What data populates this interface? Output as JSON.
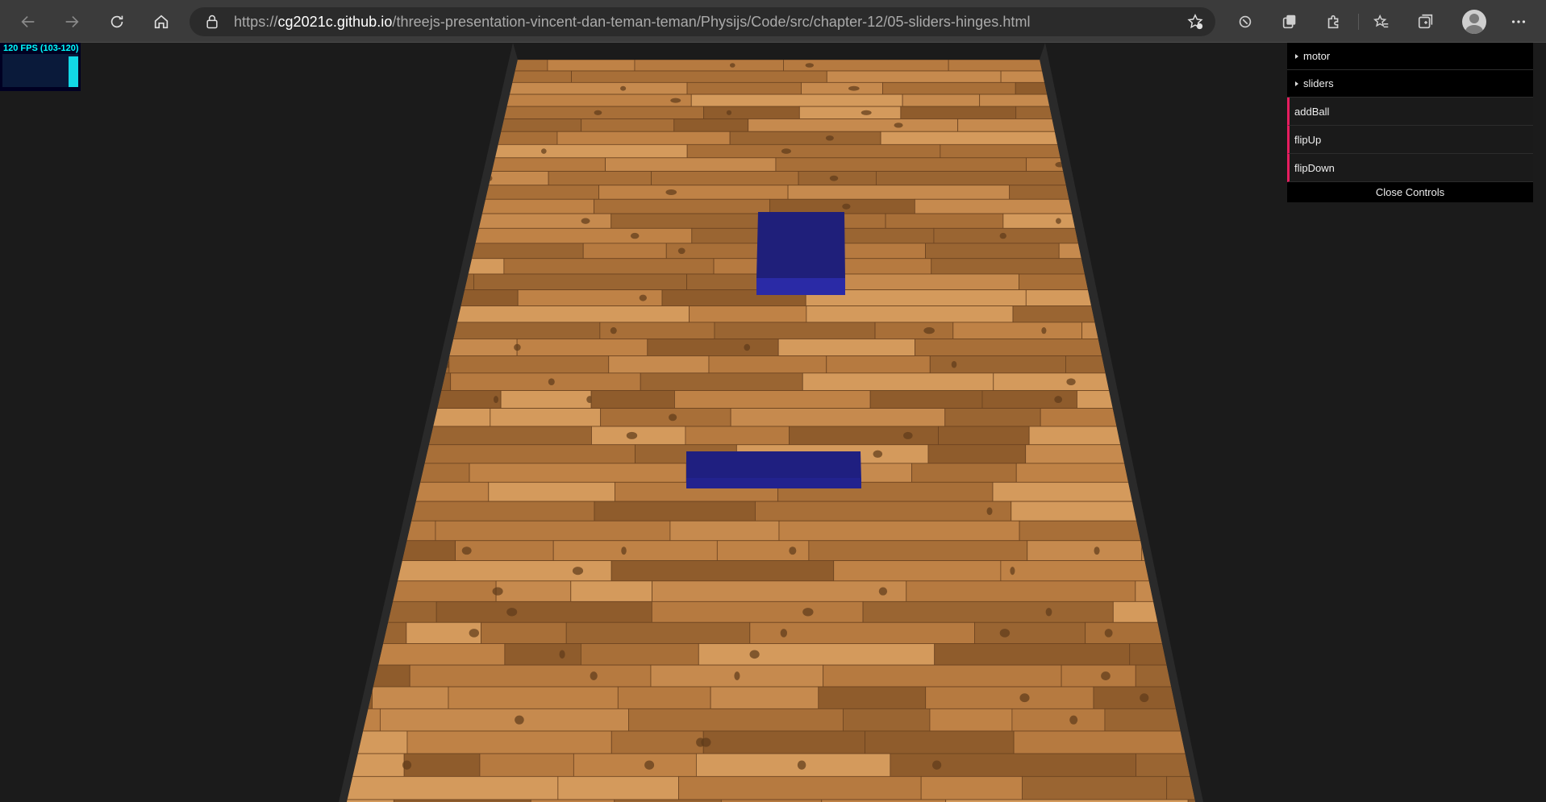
{
  "browser": {
    "url_prefix": "https://",
    "url_host": "cg2021c.github.io",
    "url_path": "/threejs-presentation-vincent-dan-teman-teman/Physijs/Code/src/chapter-12/05-sliders-hinges.html"
  },
  "stats": {
    "fps_text": "120 FPS (103-120)",
    "color": "#00ffff"
  },
  "gui": {
    "folders": [
      {
        "label": "motor"
      },
      {
        "label": "sliders"
      }
    ],
    "functions": [
      {
        "label": "addBall"
      },
      {
        "label": "flipUp"
      },
      {
        "label": "flipDown"
      }
    ],
    "close_label": "Close Controls",
    "accent_color": "#e61d5f"
  },
  "scene": {
    "floor_material": "wood planks",
    "box_color": "#1e1e8c"
  }
}
